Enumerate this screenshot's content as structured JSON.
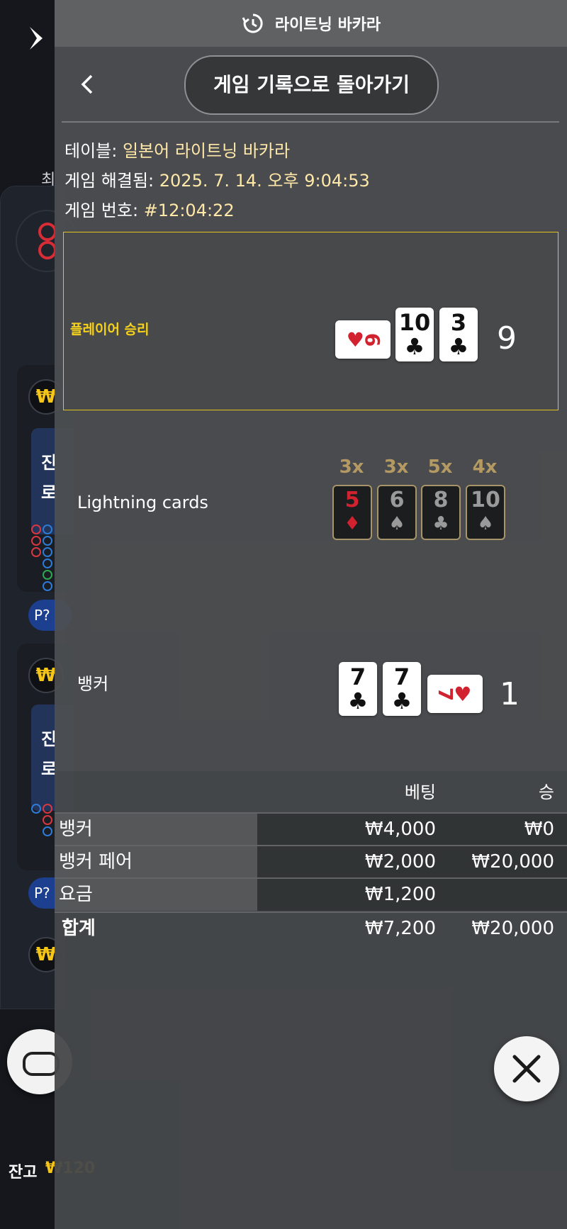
{
  "header": {
    "title": "라이트닝 바카라",
    "history_icon": "history-icon"
  },
  "nav": {
    "back_label": "게임 기록으로 돌아가기"
  },
  "info": {
    "table_label": "테이블:",
    "table_value": "일본어 라이트닝 바카라",
    "resolved_label": "게임 해결됨:",
    "resolved_value": "2025. 7. 14. 오후 9:04:53",
    "number_label": "게임 번호:",
    "number_value": "#12:04:22"
  },
  "player": {
    "result": "플레이어 승리",
    "cards": [
      {
        "rank": "6",
        "suit": "♥",
        "orientation": "horizontal",
        "color": "red"
      },
      {
        "rank": "10",
        "suit": "♣",
        "orientation": "vertical",
        "color": "black"
      },
      {
        "rank": "3",
        "suit": "♣",
        "orientation": "vertical",
        "color": "black"
      }
    ],
    "score": "9"
  },
  "lightning": {
    "label": "Lightning cards",
    "cards": [
      {
        "multiplier": "3x",
        "rank": "5",
        "suit": "♦",
        "color": "red"
      },
      {
        "multiplier": "3x",
        "rank": "6",
        "suit": "♠",
        "color": "gray"
      },
      {
        "multiplier": "5x",
        "rank": "8",
        "suit": "♣",
        "color": "gray"
      },
      {
        "multiplier": "4x",
        "rank": "10",
        "suit": "♠",
        "color": "gray"
      }
    ]
  },
  "banker": {
    "label": "뱅커",
    "cards": [
      {
        "rank": "7",
        "suit": "♣",
        "orientation": "vertical",
        "color": "black"
      },
      {
        "rank": "7",
        "suit": "♣",
        "orientation": "vertical",
        "color": "black"
      },
      {
        "rank": "7",
        "suit": "♥",
        "orientation": "horizontal",
        "color": "red"
      }
    ],
    "score": "1"
  },
  "bets": {
    "col_bet": "베팅",
    "col_win": "승",
    "rows": [
      {
        "label": "뱅커",
        "bet": "₩4,000",
        "win": "₩0"
      },
      {
        "label": "뱅커 페어",
        "bet": "₩2,000",
        "win": "₩20,000"
      },
      {
        "label": "요금",
        "bet": "₩1,200",
        "win": ""
      }
    ],
    "total": {
      "label": "합계",
      "bet": "₩7,200",
      "win": "₩20,000"
    }
  },
  "background": {
    "tab_label": "최",
    "chip_symbol": "₩",
    "promo_text": "진\n로",
    "p_badge": "P?",
    "balance_label": "잔고",
    "balance_value": "₩120"
  },
  "colors": {
    "accent_gold": "#f7d21a",
    "value_cream": "#ffe8a8",
    "red_suit": "#d3222f"
  }
}
